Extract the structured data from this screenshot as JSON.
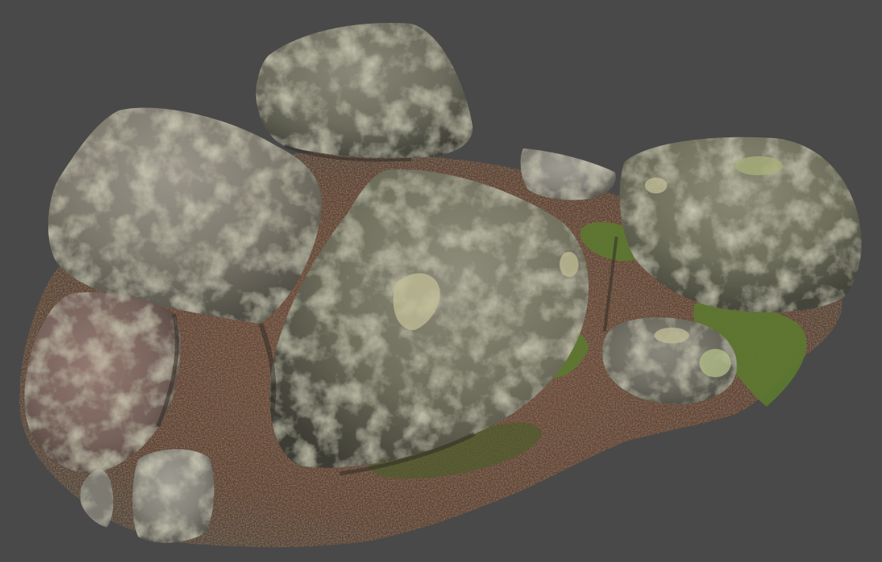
{
  "scene": {
    "background_color": "#494949",
    "subject": "photogrammetry-rock-cluster",
    "palette": {
      "rock_light": "#8f8c80",
      "rock_mid": "#6f6d62",
      "rock_dark": "#3e3d37",
      "rock_pink": "#8a716b",
      "moss": "#5e7a33",
      "lichen": "#b9b58a",
      "soil": "#6e4f3d",
      "soil_dark": "#4a3428"
    },
    "rocks": [
      {
        "id": "rock-top-center"
      },
      {
        "id": "rock-left-large"
      },
      {
        "id": "rock-center-large"
      },
      {
        "id": "rock-right-large"
      },
      {
        "id": "rock-small-flat"
      },
      {
        "id": "rock-lower-left-pink"
      },
      {
        "id": "rock-bottom-small"
      },
      {
        "id": "rock-bottom-sliver"
      },
      {
        "id": "rock-right-low"
      }
    ]
  }
}
